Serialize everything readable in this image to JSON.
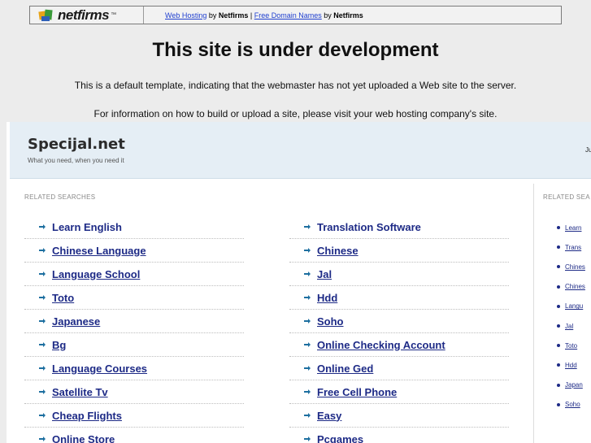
{
  "netfirms_bar": {
    "logo_text": "netfirms",
    "logo_tm": "™",
    "web_hosting_link": "Web Hosting",
    "by_1": " by ",
    "netfirms_1": "Netfirms",
    "separator": " | ",
    "free_domain_link": "Free Domain Names",
    "by_2": " by ",
    "netfirms_2": "Netfirms"
  },
  "notice": {
    "title": "This site is under development",
    "line1": "This is a default template, indicating that the webmaster has not yet uploaded a Web site to the server.",
    "line2": "For information on how to build or upload a site, please visit your web hosting company's site."
  },
  "parked": {
    "site_name": "Specijal.net",
    "tagline": "What you need, when you need it",
    "header_right": "Ju",
    "related_label": "RELATED SEARCHES",
    "related_label_side": "RELATED SEA",
    "left_column": [
      "Learn English",
      "Chinese Language",
      "Language School",
      "Toto",
      "Japanese",
      "Bg",
      "Language Courses",
      "Satellite Tv",
      "Cheap Flights",
      "Online Store"
    ],
    "right_column": [
      "Translation Software",
      "Chinese",
      "Jal",
      "Hdd",
      "Soho",
      "Online Checking Account",
      "Online Ged",
      "Free Cell Phone",
      "Easy",
      "Pcgames"
    ],
    "side_list": [
      "Learn",
      "Trans",
      "Chines",
      "Chines",
      "Langu",
      "Jal",
      "Toto",
      "Hdd",
      "Japan",
      "Soho"
    ]
  },
  "colors": {
    "link": "#1d2a86",
    "arrow": "#1d6fa0",
    "header_bg": "#e5eef5"
  }
}
